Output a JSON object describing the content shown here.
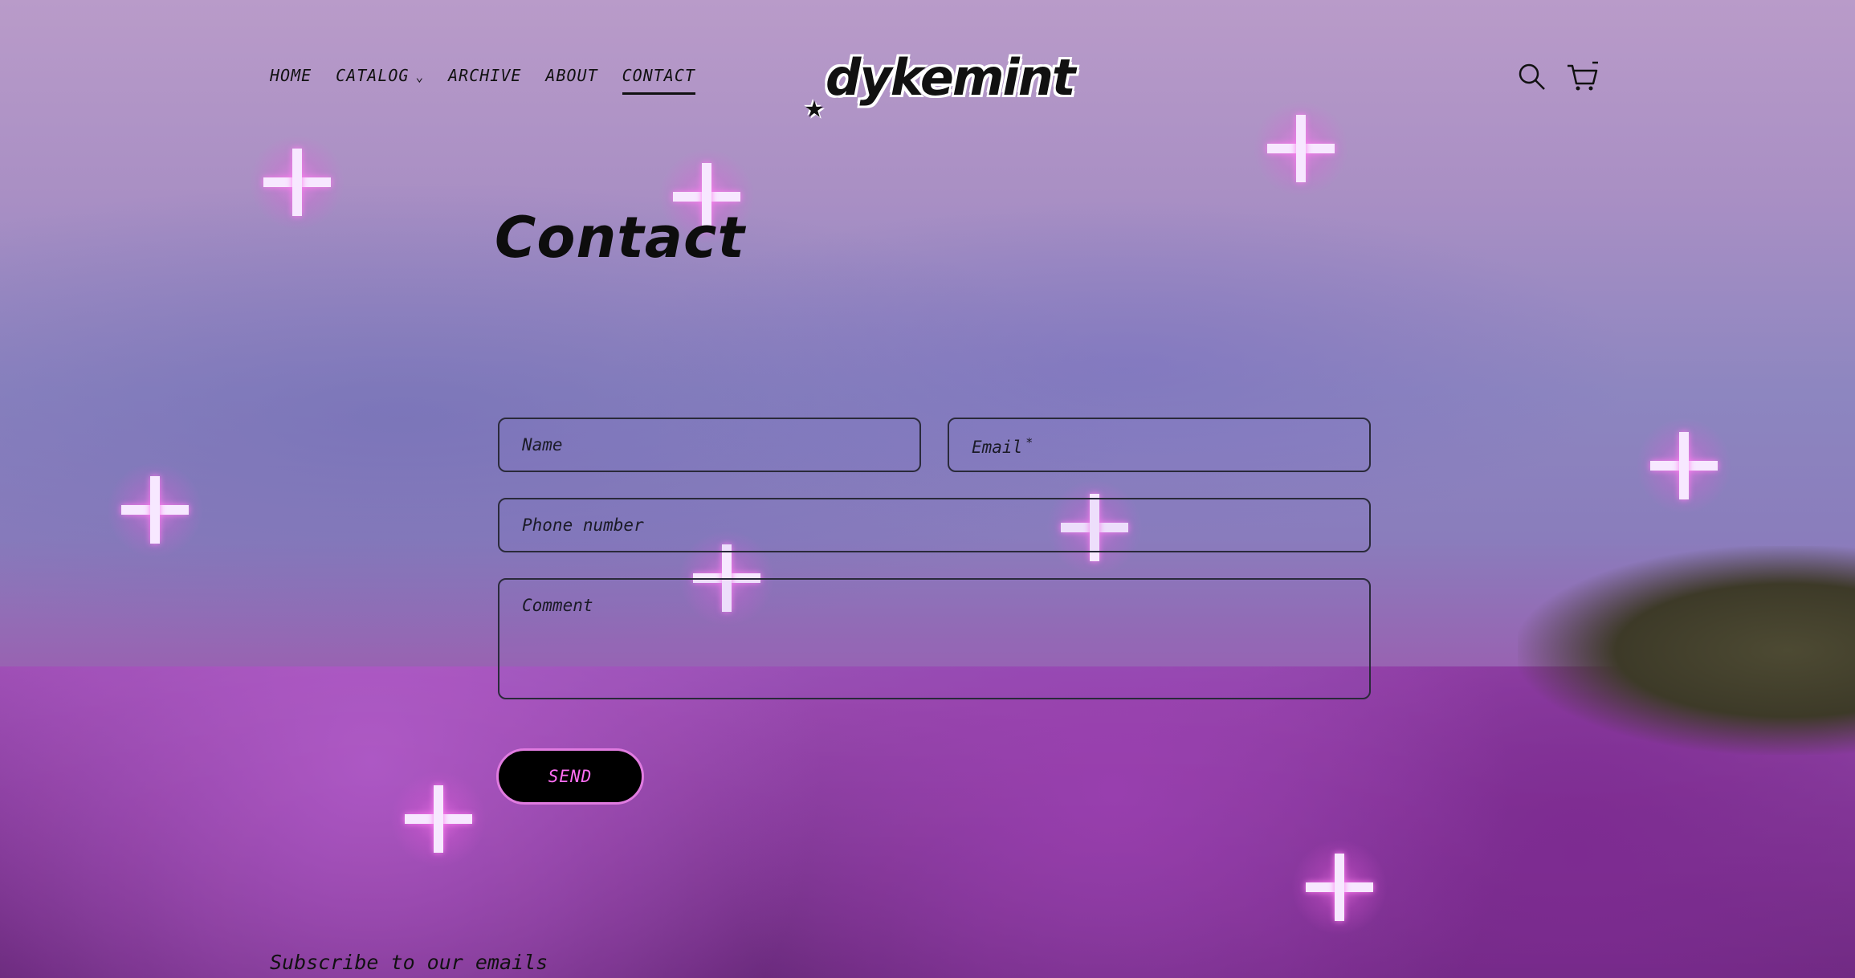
{
  "nav": {
    "items": [
      {
        "label": "HOME",
        "name": "nav-home"
      },
      {
        "label": "CATALOG",
        "name": "nav-catalog",
        "dropdown": true
      },
      {
        "label": "ARCHIVE",
        "name": "nav-archive"
      },
      {
        "label": "ABOUT",
        "name": "nav-about"
      },
      {
        "label": "CONTACT",
        "name": "nav-contact",
        "active": true
      }
    ]
  },
  "logo": {
    "text": "dykemint"
  },
  "header_icons": [
    "search-icon",
    "cart-icon"
  ],
  "page": {
    "title": "Contact"
  },
  "form": {
    "name_placeholder": "Name",
    "email_placeholder": "Email",
    "email_required_mark": "*",
    "phone_placeholder": "Phone number",
    "comment_placeholder": "Comment",
    "send_label": "SEND"
  },
  "footer": {
    "subscribe_heading": "Subscribe to our emails"
  },
  "colors": {
    "accent": "#ff6ef3",
    "button_bg": "#000000",
    "text": "#111111"
  }
}
